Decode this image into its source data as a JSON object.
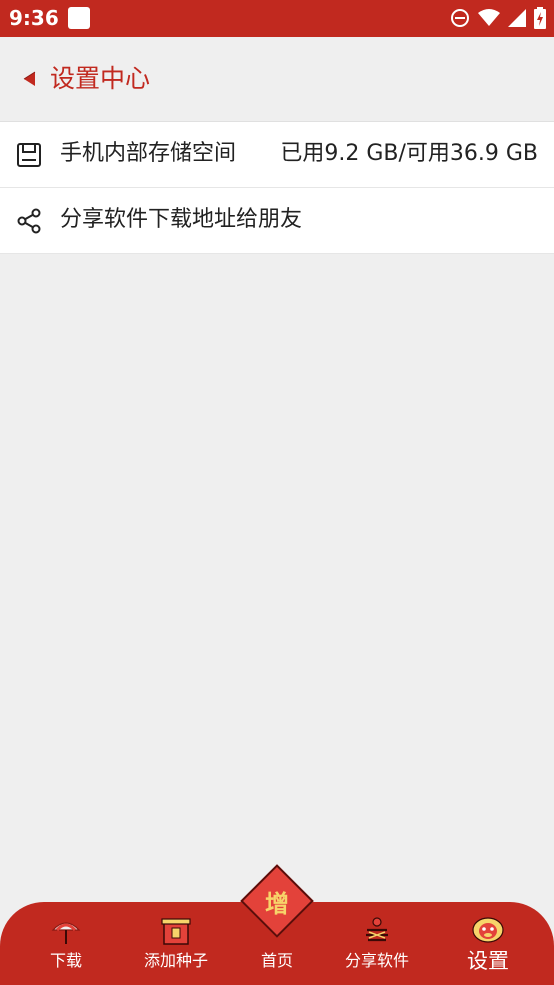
{
  "status_bar": {
    "time": "9:36",
    "icons": [
      "dnd-icon",
      "wifi-icon",
      "signal-icon",
      "battery-icon"
    ]
  },
  "header": {
    "title": "设置中心"
  },
  "settings": {
    "items": [
      {
        "icon": "storage-icon",
        "label": "手机内部存储空间",
        "value": "已用9.2 GB/可用36.9 GB"
      },
      {
        "icon": "share-icon",
        "label": "分享软件下载地址给朋友"
      }
    ]
  },
  "bottom_nav": {
    "items": [
      {
        "label": "下载",
        "icon": "umbrella-icon"
      },
      {
        "label": "添加种子",
        "icon": "seed-icon"
      },
      {
        "label": "首页",
        "icon": "home-icon",
        "glyph": "增"
      },
      {
        "label": "分享软件",
        "icon": "firework-icon"
      },
      {
        "label": "设置",
        "icon": "lion-icon"
      }
    ]
  },
  "colors": {
    "primary": "#c1291f",
    "background": "#efefef",
    "accent_gold": "#f7d46a"
  }
}
